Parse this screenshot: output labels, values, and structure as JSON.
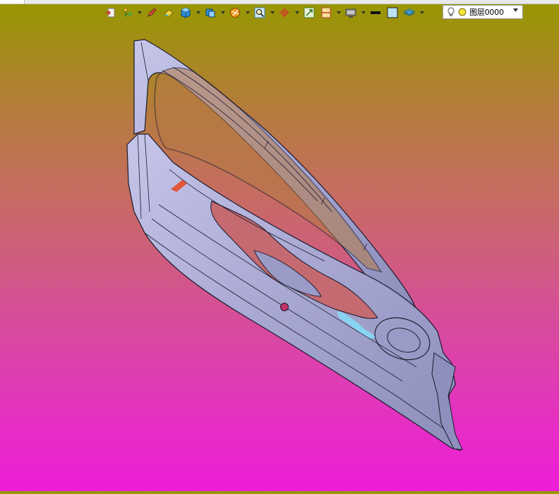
{
  "toolbar": {
    "buttons": [
      {
        "icon": "exit-icon",
        "dropdown": false
      },
      {
        "icon": "tree-pointer-icon",
        "dropdown": true
      },
      {
        "icon": "pencil-icon",
        "dropdown": false
      },
      {
        "icon": "eraser-icon",
        "dropdown": false
      },
      {
        "icon": "cube-icon",
        "dropdown": true
      },
      {
        "icon": "view-cube-icon",
        "dropdown": true
      },
      {
        "icon": "render-sphere-icon",
        "dropdown": true
      },
      {
        "icon": "zoom-icon",
        "dropdown": true
      },
      {
        "icon": "axis-icon",
        "dropdown": true
      },
      {
        "icon": "fit-view-icon",
        "dropdown": false
      },
      {
        "icon": "section-view-icon",
        "dropdown": true
      },
      {
        "icon": "display-mode-icon",
        "dropdown": true
      },
      {
        "icon": "line-weight-icon",
        "dropdown": false
      },
      {
        "icon": "fill-color-icon",
        "dropdown": false
      },
      {
        "icon": "layer-stack-icon",
        "dropdown": true
      }
    ]
  },
  "layer_selector": {
    "current_layer": "图层0000",
    "icons": [
      "light-bulb-icon",
      "visibility-dot-icon",
      "dropdown-arrow-icon"
    ]
  },
  "colors": {
    "part_fill": "#a9a9d4",
    "part_edge": "#1a1a2e",
    "background_top": "#979800",
    "background_bottom": "#ee1cd8"
  }
}
